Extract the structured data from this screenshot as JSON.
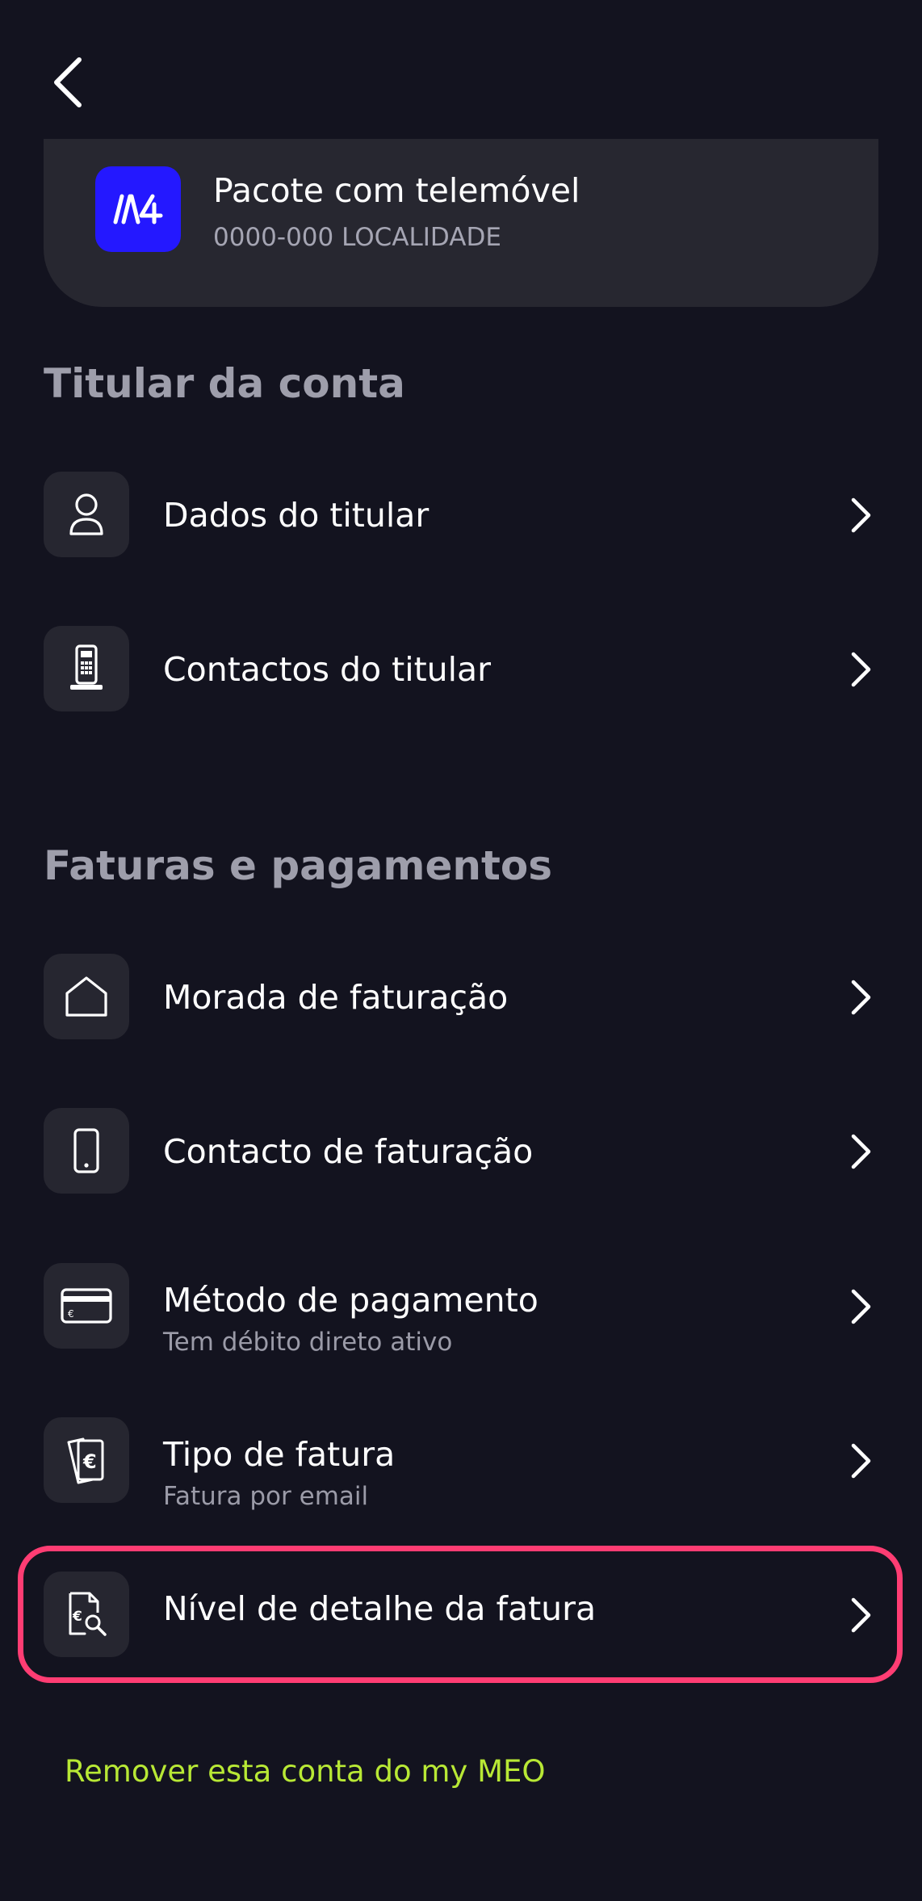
{
  "header": {
    "back_icon": "chevron-left-icon"
  },
  "account": {
    "logo_icon": "meo-logo-icon",
    "logo_text": "///4",
    "title": "Pacote com telemóvel",
    "subtitle": "0000-000 LOCALIDADE"
  },
  "sections": {
    "holder": {
      "title": "Titular da conta",
      "items": [
        {
          "label": "Dados do titular",
          "icon": "user-icon"
        },
        {
          "label": "Contactos do titular",
          "icon": "desk-phone-icon"
        }
      ]
    },
    "billing": {
      "title": "Faturas e pagamentos",
      "items": [
        {
          "label": "Morada de faturação",
          "icon": "house-icon"
        },
        {
          "label": "Contacto de faturação",
          "icon": "mobile-phone-icon"
        },
        {
          "label": "Método de pagamento",
          "sub": "Tem débito direto ativo",
          "icon": "credit-card-icon"
        },
        {
          "label": "Tipo de fatura",
          "sub": "Fatura por email",
          "icon": "invoice-euro-icon"
        },
        {
          "label": "Nível de detalhe da fatura",
          "icon": "invoice-search-icon"
        }
      ]
    }
  },
  "footer": {
    "remove_label": "Remover esta conta do my MEO"
  },
  "colors": {
    "background": "#13131f",
    "card": "#272730",
    "brand_blue": "#2418ff",
    "highlight": "#ff3d73",
    "link": "#b8e835"
  }
}
